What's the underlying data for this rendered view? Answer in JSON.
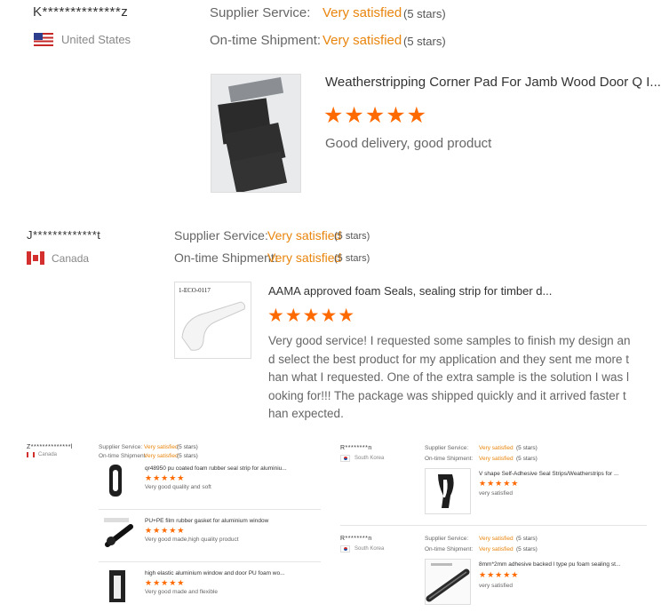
{
  "review1": {
    "name": "K**************z",
    "country": "United States",
    "service_label": "Supplier Service:",
    "service_value": "Very satisfied",
    "service_stars": "(5 stars)",
    "shipment_label": "On-time Shipment:",
    "shipment_value": "Very satisfied",
    "shipment_stars": "(5 stars)",
    "product": "Weatherstripping Corner Pad For Jamb Wood Door Q I...",
    "rating": "★★★★★",
    "comment": "Good delivery, good product"
  },
  "review2": {
    "name": "J*************t",
    "country": "Canada",
    "service_label": "Supplier Service:",
    "service_value": "Very satisfied",
    "service_stars": "(5 stars)",
    "shipment_label": "On-time Shipment:",
    "shipment_value": "Very satisfied",
    "shipment_stars": "(5 stars)",
    "thumb_label": "1-ECO-0117",
    "product": "AAMA approved foam Seals, sealing strip for timber d...",
    "rating": "★★★★★",
    "comment": "Very good service! I requested some samples to finish my design and select the best product for my application and they sent me more than what I requested. One of the extra sample is the solution I was looking for!!! The package was shipped quickly and it arrived faster than expected."
  },
  "review3": {
    "name": "Z**************l",
    "country": "Canada",
    "service_label": "Supplier Service:",
    "service_value": "Very satisfied",
    "service_stars": "(5 stars)",
    "shipment_label": "On-time Shipment:",
    "shipment_value": "Very satisfied",
    "shipment_stars": "(5 stars)",
    "items": [
      {
        "product": "qr48950 pu coated foam rubber seal strip for aluminiu...",
        "rating": "★★★★★",
        "comment": "Very good quality and soft"
      },
      {
        "product": "PU+PE film rubber gasket for aluminium window",
        "rating": "★★★★★",
        "comment": "Very good made,high quality product"
      },
      {
        "product": "high elastic aluminium window and door PU foam wo...",
        "rating": "★★★★★",
        "comment": "Very good made and flexible"
      }
    ]
  },
  "review4": {
    "name": "R********n",
    "country": "South Korea",
    "service_label": "Supplier Service:",
    "service_value": "Very satisfied",
    "service_stars": "(5 stars)",
    "shipment_label": "On-time Shipment:",
    "shipment_value": "Very satisfied",
    "shipment_stars": "(5 stars)",
    "product": "V shape Self-Adhesive Seal Strips/Weatherstrips for ...",
    "rating": "★★★★★",
    "comment": "very satisfied"
  },
  "review5": {
    "name": "R********n",
    "country": "South Korea",
    "service_label": "Supplier Service:",
    "service_value": "Very satisfied",
    "service_stars": "(5 stars)",
    "shipment_label": "On-time Shipment:",
    "shipment_value": "Very satisfied",
    "shipment_stars": "(5 stars)",
    "product": "8mm*2mm adhesive backed l type pu foam sealing st...",
    "rating": "★★★★★",
    "comment": "very satisfied"
  },
  "colors": {
    "satisfied": "#e8850c",
    "stars": "#ff6a00"
  },
  "icons": {
    "us_flag": "us-flag-icon",
    "ca_flag": "canada-flag-icon",
    "kr_flag": "south-korea-flag-icon"
  }
}
